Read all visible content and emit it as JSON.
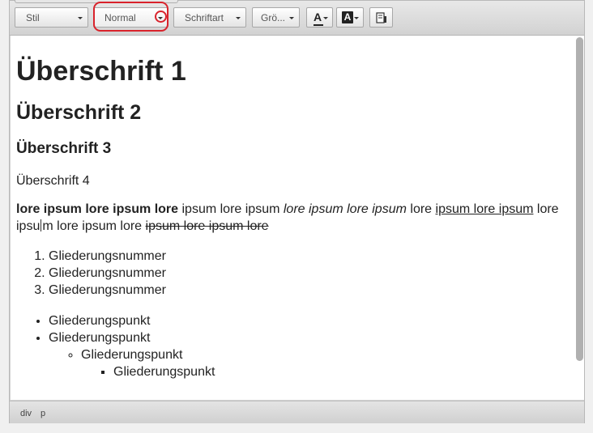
{
  "toolbar": {
    "style_combo": {
      "label": "Stil"
    },
    "format_combo": {
      "label": "Normal"
    },
    "font_combo": {
      "label": "Schriftart"
    },
    "size_combo": {
      "label": "Grö..."
    },
    "text_color_glyph": "A",
    "bg_color_glyph": "A"
  },
  "content": {
    "heading1": "Überschrift 1",
    "heading2": "Überschrift 2",
    "heading3": "Überschrift 3",
    "heading4": "Überschrift 4",
    "paragraph": {
      "bold": "lore ipsum lore ipsum lore",
      "normal1": " ipsum lore ipsum ",
      "italic": "lore ipsum lore ipsum",
      "normal2": " lore ",
      "underline": "ipsum lore ipsum",
      "normal3a": " lore ipsu",
      "normal3b": "m lore ipsum lore ",
      "strike": "ipsum lore ipsum lore "
    },
    "ordered_list": [
      "Gliederungsnummer",
      "Gliederungsnummer",
      "Gliederungsnummer"
    ],
    "bullet_list": [
      "Gliederungspunkt",
      "Gliederungspunkt"
    ],
    "bullet_level2": "Gliederungspunkt",
    "bullet_level3": "Gliederungspunkt"
  },
  "statusbar": {
    "path": [
      "div",
      "p"
    ]
  },
  "colors": {
    "highlight_ring": "#d9232c",
    "scroll_thumb": "#b0b0b0"
  }
}
